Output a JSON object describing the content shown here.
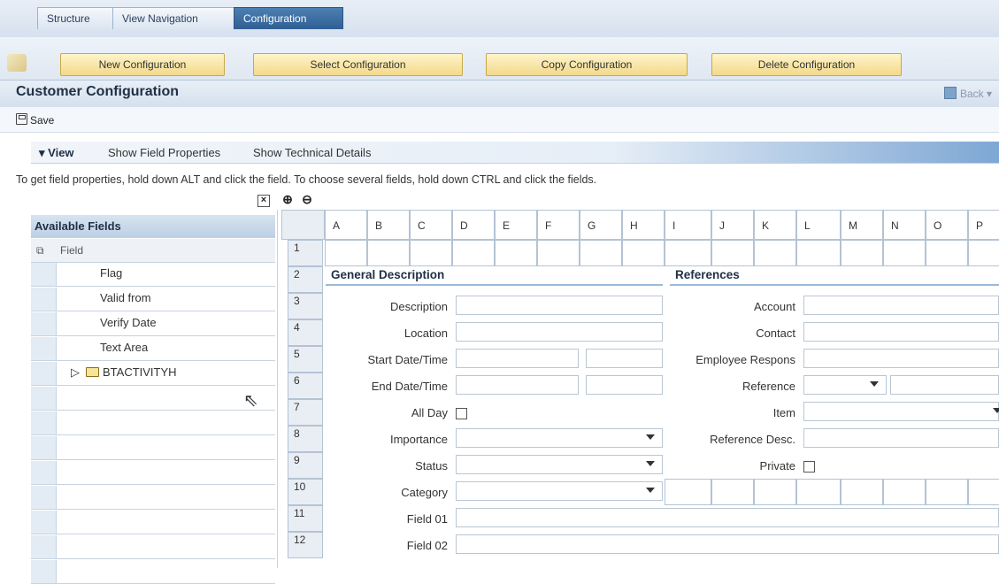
{
  "tabs": [
    {
      "label": "Structure",
      "active": false
    },
    {
      "label": "View Navigation",
      "active": false
    },
    {
      "label": "Configuration",
      "active": true
    }
  ],
  "config_buttons": {
    "new": "New Configuration",
    "select": "Select Configuration",
    "copy": "Copy Configuration",
    "delete": "Delete Configuration"
  },
  "page_title": "Customer Configuration",
  "back_label": "Back",
  "save_label": "Save",
  "view": {
    "label": "View",
    "show_field_properties": "Show Field Properties",
    "show_technical_details": "Show Technical Details"
  },
  "hint": "To get field properties, hold down ALT and click the field. To choose several fields, hold down CTRL and click the fields.",
  "available_fields": {
    "title": "Available Fields",
    "column_header": "Field",
    "items": [
      "Flag",
      "Valid from",
      "Verify Date",
      "Text Area"
    ],
    "folder": "BTACTIVITYH"
  },
  "grid": {
    "columns": [
      "A",
      "B",
      "C",
      "D",
      "E",
      "F",
      "G",
      "H",
      "I",
      "J",
      "K",
      "L",
      "M",
      "N",
      "O",
      "P"
    ],
    "rows": [
      "1",
      "2",
      "3",
      "4",
      "5",
      "6",
      "7",
      "8",
      "9",
      "10",
      "11",
      "12"
    ],
    "section_left": "General Description",
    "section_right": "References",
    "left_labels": {
      "description": "Description",
      "location": "Location",
      "start": "Start Date/Time",
      "end": "End Date/Time",
      "allday": "All Day",
      "importance": "Importance",
      "status": "Status",
      "category": "Category",
      "field01": "Field 01",
      "field02": "Field 02"
    },
    "right_labels": {
      "account": "Account",
      "contact": "Contact",
      "employee": "Employee Respons",
      "reference": "Reference",
      "item": "Item",
      "refdesc": "Reference Desc.",
      "private": "Private"
    }
  },
  "icons": [
    "pencil-icon",
    "back-icon",
    "save-icon",
    "close-icon",
    "add-row-icon",
    "remove-row-icon",
    "hierarchy-icon",
    "expand-icon",
    "folder-icon",
    "mouse-cursor-icon",
    "dropdown-icon",
    "checkbox-icon"
  ]
}
